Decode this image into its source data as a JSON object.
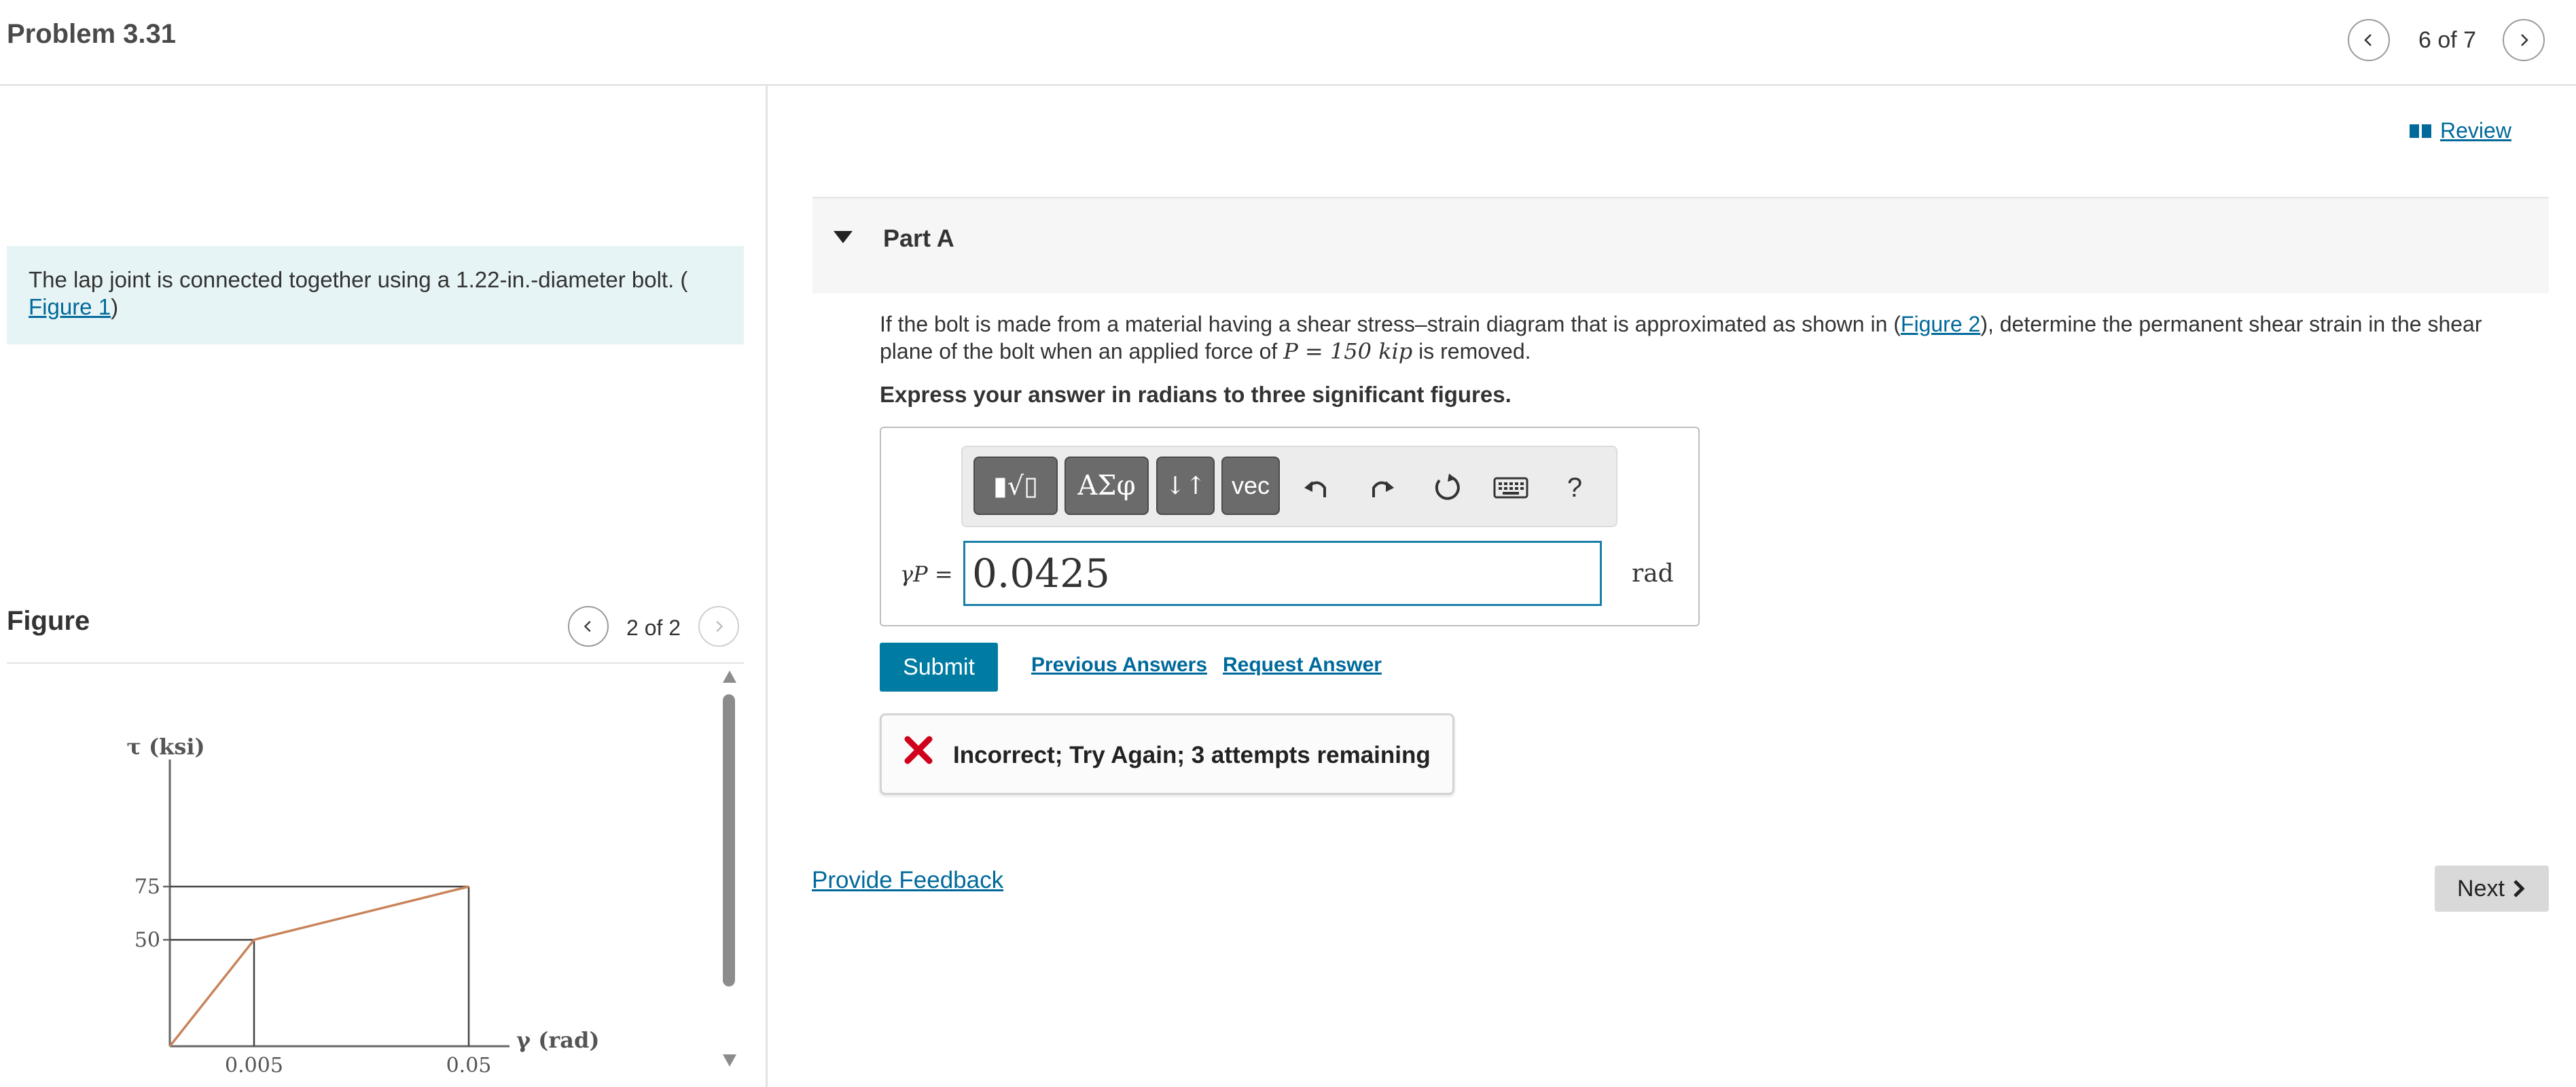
{
  "header": {
    "title": "Problem 3.31",
    "counter": "6 of 7"
  },
  "intro": {
    "text_before": "The lap joint is connected together using a 1.22-in.-diameter bolt. (",
    "figure_link": "Figure 1",
    "text_after": ")"
  },
  "figure": {
    "heading": "Figure",
    "counter": "2 of 2"
  },
  "chart_data": {
    "type": "line",
    "ylabel": "τ (ksi)",
    "xlabel": "γ (rad)",
    "y_ticks": [
      "50",
      "75"
    ],
    "x_ticks": [
      "0.005",
      "0.05"
    ],
    "series": [
      {
        "x": [
          0,
          0.005,
          0.05
        ],
        "y": [
          0,
          50,
          75
        ]
      }
    ]
  },
  "review": {
    "label": "Review"
  },
  "part": {
    "title": "Part A",
    "question_before": "If the bolt is made from a material having a shear stress–strain diagram that is approximated as shown in (",
    "question_link": "Figure 2",
    "question_mid": "), determine the permanent shear strain in the shear plane of the bolt when an applied force of ",
    "question_math": "P = 150 kip",
    "question_after": " is removed.",
    "instruction": "Express your answer in radians to three significant figures."
  },
  "toolbar": {
    "templates": "▮√▯",
    "greek": "ΑΣφ",
    "arrows": "↓↑",
    "vec": "vec",
    "help": "?"
  },
  "answer": {
    "label": "γP =",
    "value": "0.0425",
    "unit": "rad"
  },
  "actions": {
    "submit": "Submit",
    "previous_answers": "Previous Answers",
    "request_answer": "Request Answer"
  },
  "feedback": {
    "message": "Incorrect; Try Again; 3 attempts remaining"
  },
  "footer": {
    "provide_feedback": "Provide Feedback",
    "next": "Next"
  },
  "colors": {
    "accent": "#007ca3",
    "link": "#00699b",
    "intro_bg": "#e7f4f6",
    "curve": "#c8845a",
    "error": "#d0021b"
  }
}
